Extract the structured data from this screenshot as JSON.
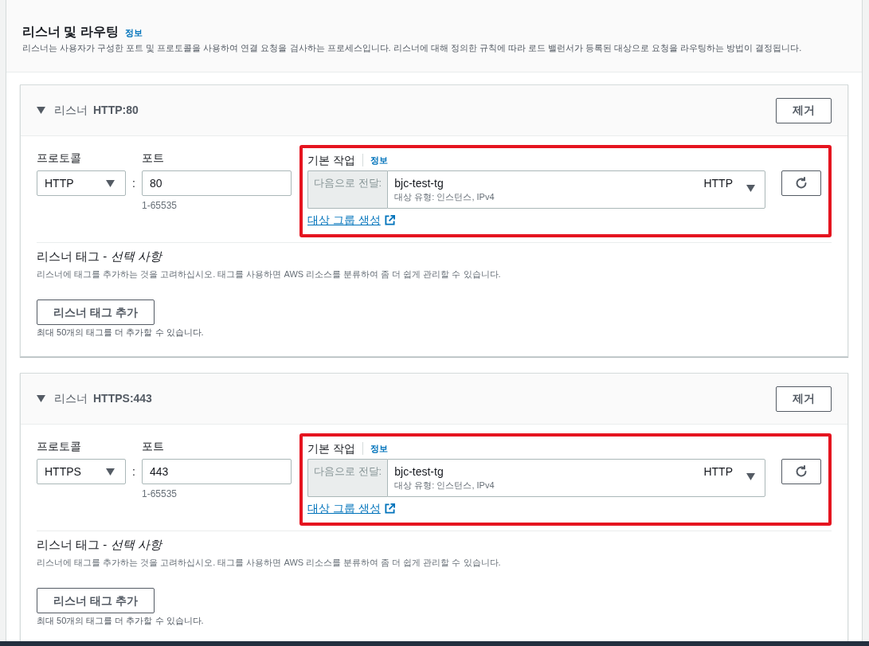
{
  "section": {
    "title": "리스너 및 라우팅",
    "info_link": "정보",
    "description": "리스너는 사용자가 구성한 포트 및 프로토콜을 사용하여 연결 요청을 검사하는 프로세스입니다. 리스너에 대해 정의한 규칙에 따라 로드 밸런서가 등록된 대상으로 요청을 라우팅하는 방법이 결정됩니다."
  },
  "listeners": [
    {
      "expanded": true,
      "label": "리스너",
      "name": "HTTP:80",
      "remove_button": "제거",
      "protocol": {
        "label": "프로토콜",
        "value": "HTTP"
      },
      "separator": ":",
      "port": {
        "label": "포트",
        "value": "80",
        "hint": "1-65535"
      },
      "default_action": {
        "label": "기본 작업",
        "info_link": "정보",
        "highlighted": true,
        "action_label": "다음으로 전달:",
        "target_group": "bjc-test-tg",
        "target_type": "대상 유형: 인스턴스, IPv4",
        "protocol": "HTTP",
        "create_link": "대상 그룹 생성"
      },
      "tags": {
        "title": "리스너 태그 - *선택 사항*",
        "description": "리스너에 태그를 추가하는 것을 고려하십시오. 태그를 사용하면 AWS 리소스를 분류하여 좀 더 쉽게 관리할 수 있습니다.",
        "add_button": "리스너 태그 추가",
        "limit_note": "최대 50개의 태그를 더 추가할 수 있습니다."
      }
    },
    {
      "expanded": true,
      "label": "리스너",
      "name": "HTTPS:443",
      "remove_button": "제거",
      "protocol": {
        "label": "프로토콜",
        "value": "HTTPS"
      },
      "separator": ":",
      "port": {
        "label": "포트",
        "value": "443",
        "hint": "1-65535"
      },
      "default_action": {
        "label": "기본 작업",
        "info_link": "정보",
        "highlighted": true,
        "action_label": "다음으로 전달:",
        "target_group": "bjc-test-tg",
        "target_type": "대상 유형: 인스턴스, IPv4",
        "protocol": "HTTP",
        "create_link": "대상 그룹 생성"
      },
      "tags": {
        "title": "리스너 태그 - *선택 사항*",
        "description": "리스너에 태그를 추가하는 것을 고려하십시오. 태그를 사용하면 AWS 리소스를 분류하여 좀 더 쉽게 관리할 수 있습니다.",
        "add_button": "리스너 태그 추가",
        "limit_note": "최대 50개의 태그를 더 추가할 수 있습니다."
      }
    }
  ]
}
